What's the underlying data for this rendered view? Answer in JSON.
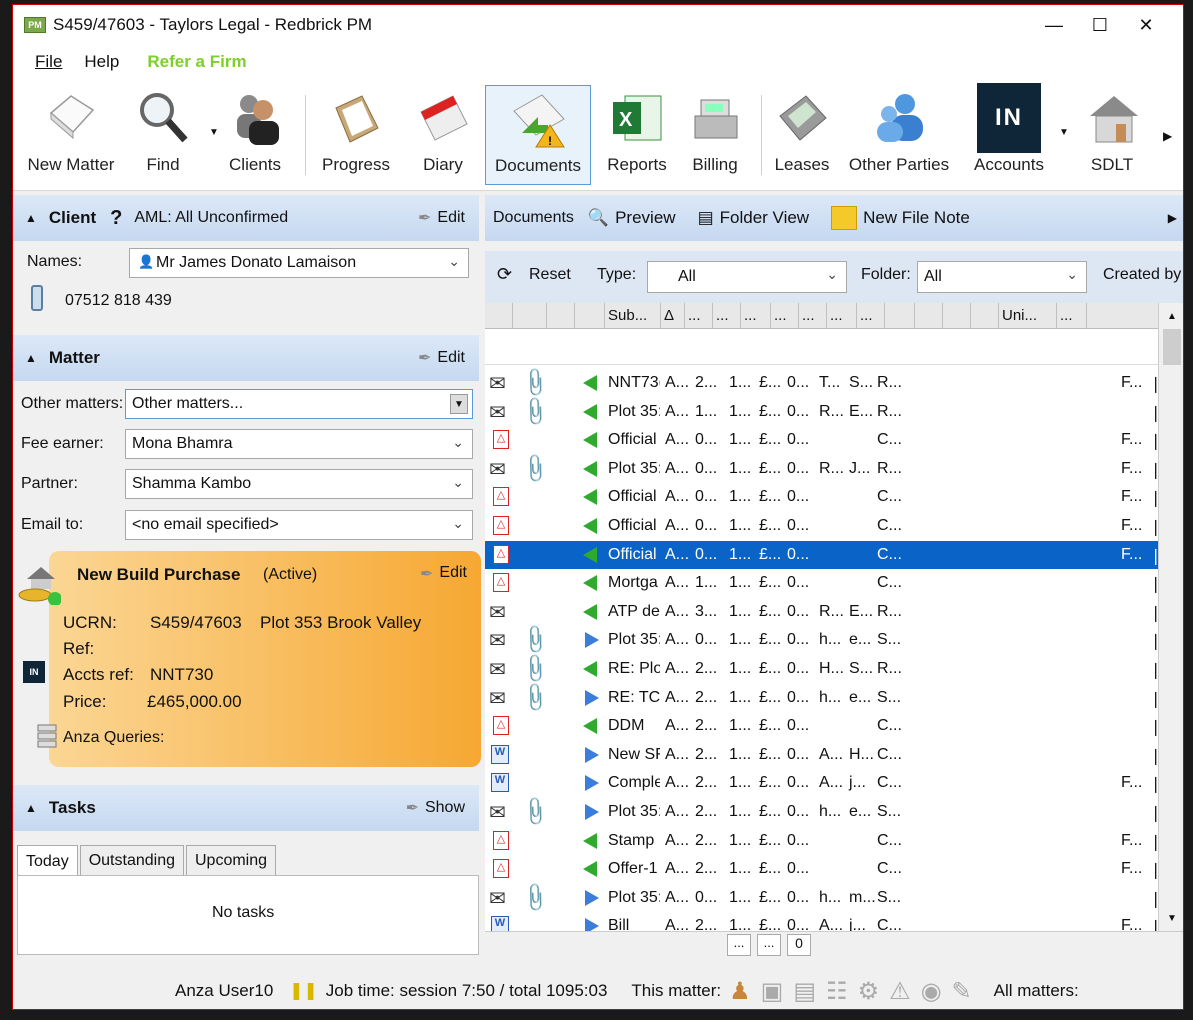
{
  "window": {
    "title": "S459/47603 - Taylors Legal - Redbrick PM",
    "app_badge": "PM"
  },
  "menu": {
    "file": "File",
    "help": "Help",
    "refer": "Refer a Firm"
  },
  "toolbar": [
    {
      "id": "new-matter",
      "label": "New Matter"
    },
    {
      "id": "find",
      "label": "Find"
    },
    {
      "id": "clients",
      "label": "Clients"
    },
    {
      "id": "progress",
      "label": "Progress"
    },
    {
      "id": "diary",
      "label": "Diary"
    },
    {
      "id": "documents",
      "label": "Documents"
    },
    {
      "id": "reports",
      "label": "Reports"
    },
    {
      "id": "billing",
      "label": "Billing"
    },
    {
      "id": "leases",
      "label": "Leases"
    },
    {
      "id": "other-parties",
      "label": "Other Parties"
    },
    {
      "id": "accounts",
      "label": "Accounts"
    },
    {
      "id": "sdlt",
      "label": "SDLT"
    }
  ],
  "accounts_badge": "IN",
  "client": {
    "title": "Client",
    "aml": "AML: All Unconfirmed",
    "edit": "Edit",
    "names_label": "Names:",
    "name": "Mr James Donato Lamaison",
    "phone": "07512 818 439"
  },
  "matter": {
    "title": "Matter",
    "edit": "Edit",
    "other_label": "Other matters:",
    "other_value": "Other matters...",
    "fee_label": "Fee earner:",
    "fee_value": "Mona Bhamra",
    "partner_label": "Partner:",
    "partner_value": "Shamma Kambo",
    "email_label": "Email to:",
    "email_value": "<no email specified>"
  },
  "build": {
    "title": "New Build Purchase",
    "status": "(Active)",
    "edit": "Edit",
    "ucrn_label": "UCRN:",
    "ucrn": "S459/47603",
    "plot": "Plot 353 Brook Valley",
    "ref_label": "Ref:",
    "accts_label": "Accts ref:",
    "accts": "NNT730",
    "price_label": "Price:",
    "price": "£465,000.00",
    "anza": "Anza Queries:"
  },
  "tasks": {
    "title": "Tasks",
    "show": "Show",
    "tabs": [
      "Today",
      "Outstanding",
      "Upcoming"
    ],
    "empty": "No tasks"
  },
  "doc_toolbar": {
    "documents": "Documents",
    "preview": "Preview",
    "folder_view": "Folder View",
    "new_file_note": "New File Note"
  },
  "filters": {
    "reset": "Reset",
    "type_label": "Type:",
    "type_value": "All",
    "folder_label": "Folder:",
    "folder_value": "All",
    "created_by": "Created by"
  },
  "columns": [
    "Sub...",
    "Δ",
    "...",
    "...",
    "...",
    "...",
    "...",
    "...",
    "...",
    "Uni...",
    "..."
  ],
  "rows": [
    {
      "t": "mail",
      "clip": true,
      "dir": "in",
      "s": "NNT73(",
      "c": [
        "A...",
        "2...",
        "1...",
        "£...",
        "0...",
        "T...",
        "S...",
        "R..."
      ],
      "f": "F...",
      "sel": false
    },
    {
      "t": "mail",
      "clip": true,
      "dir": "in",
      "s": "Plot 35:",
      "c": [
        "A...",
        "1...",
        "1...",
        "£...",
        "0...",
        "R...",
        "E...",
        "R..."
      ],
      "f": "",
      "sel": false
    },
    {
      "t": "pdf",
      "clip": false,
      "dir": "in",
      "s": "Official",
      "c": [
        "A...",
        "0...",
        "1...",
        "£...",
        "0...",
        "",
        "",
        "C..."
      ],
      "f": "F...",
      "sel": false
    },
    {
      "t": "mail",
      "clip": true,
      "dir": "in",
      "s": "Plot 35:",
      "c": [
        "A...",
        "0...",
        "1...",
        "£...",
        "0...",
        "R...",
        "J...",
        "R..."
      ],
      "f": "F...",
      "sel": false
    },
    {
      "t": "pdf",
      "clip": false,
      "dir": "in",
      "s": "Official",
      "c": [
        "A...",
        "0...",
        "1...",
        "£...",
        "0...",
        "",
        "",
        "C..."
      ],
      "f": "F...",
      "sel": false
    },
    {
      "t": "pdf",
      "clip": false,
      "dir": "in",
      "s": "Official",
      "c": [
        "A...",
        "0...",
        "1...",
        "£...",
        "0...",
        "",
        "",
        "C..."
      ],
      "f": "F...",
      "sel": false
    },
    {
      "t": "pdf",
      "clip": false,
      "dir": "in",
      "s": "Official",
      "c": [
        "A...",
        "0...",
        "1...",
        "£...",
        "0...",
        "",
        "",
        "C..."
      ],
      "f": "F...",
      "sel": true
    },
    {
      "t": "pdf",
      "clip": false,
      "dir": "in",
      "s": "Mortga",
      "c": [
        "A...",
        "1...",
        "1...",
        "£...",
        "0...",
        "",
        "",
        "C..."
      ],
      "f": "",
      "sel": false
    },
    {
      "t": "mail",
      "clip": false,
      "dir": "in",
      "s": "ATP de",
      "c": [
        "A...",
        "3...",
        "1...",
        "£...",
        "0...",
        "R...",
        "E...",
        "R..."
      ],
      "f": "",
      "sel": false
    },
    {
      "t": "mail",
      "clip": true,
      "dir": "out",
      "s": "Plot 35:",
      "c": [
        "A...",
        "0...",
        "1...",
        "£...",
        "0...",
        "h...",
        "e...",
        "S..."
      ],
      "f": "",
      "sel": false
    },
    {
      "t": "mail",
      "clip": true,
      "dir": "in",
      "s": "RE: Plo",
      "c": [
        "A...",
        "2...",
        "1...",
        "£...",
        "0...",
        "H...",
        "S...",
        "R..."
      ],
      "f": "",
      "sel": false
    },
    {
      "t": "mail",
      "clip": true,
      "dir": "out",
      "s": "RE: TC",
      "c": [
        "A...",
        "2...",
        "1...",
        "£...",
        "0...",
        "h...",
        "e...",
        "S..."
      ],
      "f": "",
      "sel": false
    },
    {
      "t": "pdf",
      "clip": false,
      "dir": "in",
      "s": "DDM",
      "c": [
        "A...",
        "2...",
        "1...",
        "£...",
        "0...",
        "",
        "",
        "C..."
      ],
      "f": "",
      "sel": false
    },
    {
      "t": "word",
      "clip": false,
      "dir": "out",
      "s": "New SF",
      "c": [
        "A...",
        "2...",
        "1...",
        "£...",
        "0...",
        "A...",
        "H...",
        "C..."
      ],
      "f": "",
      "sel": false
    },
    {
      "t": "word",
      "clip": false,
      "dir": "out",
      "s": "Comple",
      "c": [
        "A...",
        "2...",
        "1...",
        "£...",
        "0...",
        "A...",
        "j...",
        "C..."
      ],
      "f": "F...",
      "sel": false
    },
    {
      "t": "mail",
      "clip": true,
      "dir": "out",
      "s": "Plot 35:",
      "c": [
        "A...",
        "2...",
        "1...",
        "£...",
        "0...",
        "h...",
        "e...",
        "S..."
      ],
      "f": "",
      "sel": false
    },
    {
      "t": "pdf",
      "clip": false,
      "dir": "in",
      "s": "Stamp I",
      "c": [
        "A...",
        "2...",
        "1...",
        "£...",
        "0...",
        "",
        "",
        "C..."
      ],
      "f": "F...",
      "sel": false
    },
    {
      "t": "pdf",
      "clip": false,
      "dir": "in",
      "s": "Offer-1",
      "c": [
        "A...",
        "2...",
        "1...",
        "£...",
        "0...",
        "",
        "",
        "C..."
      ],
      "f": "F...",
      "sel": false
    },
    {
      "t": "mail",
      "clip": true,
      "dir": "out",
      "s": "Plot 35:",
      "c": [
        "A...",
        "0...",
        "1...",
        "£...",
        "0...",
        "h...",
        "m...",
        "S..."
      ],
      "f": "",
      "sel": false
    },
    {
      "t": "word",
      "clip": false,
      "dir": "out",
      "s": "Bill",
      "c": [
        "A...",
        "2...",
        "1...",
        "£...",
        "0...",
        "A...",
        "j...",
        "C..."
      ],
      "f": "F...",
      "sel": false
    }
  ],
  "hscroll": {
    "b1": "...",
    "b2": "...",
    "count": "0"
  },
  "status": {
    "user": "Anza User10",
    "job": "Job time: session 7:50 / total 1095:03",
    "this": "This matter:",
    "all": "All matters:"
  }
}
